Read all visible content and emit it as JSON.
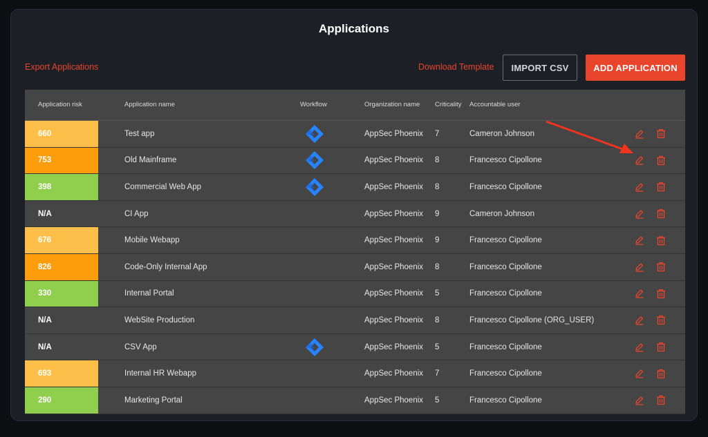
{
  "page": {
    "title": "Applications",
    "export_link": "Export Applications",
    "download_link": "Download Template",
    "import_button": "IMPORT CSV",
    "add_button": "ADD APPLICATION"
  },
  "table": {
    "headers": {
      "risk": "Application risk",
      "name": "Application name",
      "workflow": "Workflow",
      "org": "Organization name",
      "criticality": "Criticality",
      "user": "Accountable user"
    },
    "rows": [
      {
        "risk": "660",
        "risk_color": "#fdbe4a",
        "name": "Test app",
        "workflow": "jira-icon",
        "org": "AppSec Phoenix",
        "criticality": "7",
        "user": "Cameron Johnson"
      },
      {
        "risk": "753",
        "risk_color": "#fd9d0c",
        "name": "Old Mainframe",
        "workflow": "jira-icon",
        "org": "AppSec Phoenix",
        "criticality": "8",
        "user": "Francesco Cipollone"
      },
      {
        "risk": "398",
        "risk_color": "#8fcf4d",
        "name": "Commercial Web App",
        "workflow": "jira-icon",
        "org": "AppSec Phoenix",
        "criticality": "8",
        "user": "Francesco Cipollone"
      },
      {
        "risk": "N/A",
        "risk_color": "#454545",
        "name": "CI App",
        "workflow": "",
        "org": "AppSec Phoenix",
        "criticality": "9",
        "user": "Cameron Johnson"
      },
      {
        "risk": "676",
        "risk_color": "#fdbe4a",
        "name": "Mobile Webapp",
        "workflow": "",
        "org": "AppSec Phoenix",
        "criticality": "9",
        "user": "Francesco Cipollone"
      },
      {
        "risk": "826",
        "risk_color": "#fd9d0c",
        "name": "Code-Only Internal App",
        "workflow": "",
        "org": "AppSec Phoenix",
        "criticality": "8",
        "user": "Francesco Cipollone"
      },
      {
        "risk": "330",
        "risk_color": "#8fcf4d",
        "name": "Internal Portal",
        "workflow": "",
        "org": "AppSec Phoenix",
        "criticality": "5",
        "user": "Francesco Cipollone"
      },
      {
        "risk": "N/A",
        "risk_color": "#454545",
        "name": "WebSite Production",
        "workflow": "",
        "org": "AppSec Phoenix",
        "criticality": "8",
        "user": "Francesco Cipollone (ORG_USER)"
      },
      {
        "risk": "N/A",
        "risk_color": "#454545",
        "name": "CSV App",
        "workflow": "jira-icon",
        "org": "AppSec Phoenix",
        "criticality": "5",
        "user": "Francesco Cipollone"
      },
      {
        "risk": "693",
        "risk_color": "#fdbe4a",
        "name": "Internal HR Webapp",
        "workflow": "",
        "org": "AppSec Phoenix",
        "criticality": "7",
        "user": "Francesco Cipollone"
      },
      {
        "risk": "290",
        "risk_color": "#8fcf4d",
        "name": "Marketing Portal",
        "workflow": "",
        "org": "AppSec Phoenix",
        "criticality": "5",
        "user": "Francesco Cipollone"
      }
    ]
  },
  "colors": {
    "accent": "#e8452c",
    "jira_blue": "#2684ff"
  }
}
